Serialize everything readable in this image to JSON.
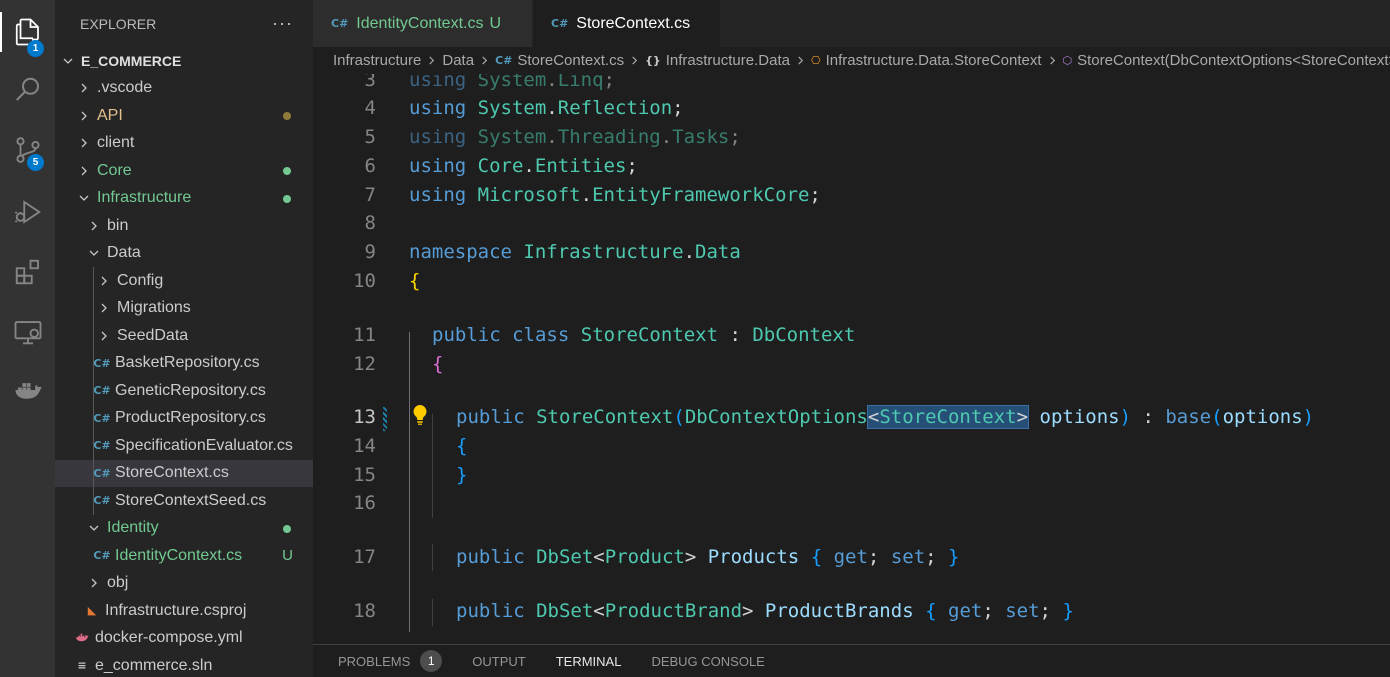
{
  "activity_bar": {
    "items": [
      {
        "name": "explorer-icon",
        "badge": "1"
      },
      {
        "name": "search-icon",
        "badge": ""
      },
      {
        "name": "source-control-icon",
        "badge": "5"
      },
      {
        "name": "run-debug-icon",
        "badge": ""
      },
      {
        "name": "extensions-icon",
        "badge": ""
      },
      {
        "name": "remote-explorer-icon",
        "badge": ""
      },
      {
        "name": "docker-icon",
        "badge": ""
      }
    ]
  },
  "sidebar": {
    "title": "EXPLORER",
    "more": "···",
    "root": "E_COMMERCE",
    "items": [
      {
        "label": ".vscode"
      },
      {
        "label": "API"
      },
      {
        "label": "client"
      },
      {
        "label": "Core"
      },
      {
        "label": "Infrastructure"
      },
      {
        "label": "bin"
      },
      {
        "label": "Data"
      },
      {
        "label": "Config"
      },
      {
        "label": "Migrations"
      },
      {
        "label": "SeedData"
      },
      {
        "label": "BasketRepository.cs"
      },
      {
        "label": "GeneticRepository.cs"
      },
      {
        "label": "ProductRepository.cs"
      },
      {
        "label": "SpecificationEvaluator.cs"
      },
      {
        "label": "StoreContext.cs"
      },
      {
        "label": "StoreContextSeed.cs"
      },
      {
        "label": "Identity"
      },
      {
        "label": "IdentityContext.cs",
        "status": "U"
      },
      {
        "label": "obj"
      },
      {
        "label": "Infrastructure.csproj"
      },
      {
        "label": "docker-compose.yml"
      },
      {
        "label": "e_commerce.sln"
      }
    ]
  },
  "tabs": [
    {
      "label": "IdentityContext.cs",
      "status": "U"
    },
    {
      "label": "StoreContext.cs"
    }
  ],
  "breadcrumb": [
    "Infrastructure",
    "Data",
    "StoreContext.cs",
    "Infrastructure.Data",
    "Infrastructure.Data.StoreContext",
    "StoreContext(DbContextOptions<StoreContext> options)"
  ],
  "editor": {
    "line_numbers": [
      "3",
      "4",
      "5",
      "6",
      "7",
      "8",
      "9",
      "10",
      "11",
      "12",
      "13",
      "14",
      "15",
      "16",
      "17",
      "18"
    ],
    "current_line": "13"
  },
  "panel": {
    "tabs": [
      "PROBLEMS",
      "OUTPUT",
      "TERMINAL",
      "DEBUG CONSOLE"
    ],
    "problems_count": "1"
  }
}
